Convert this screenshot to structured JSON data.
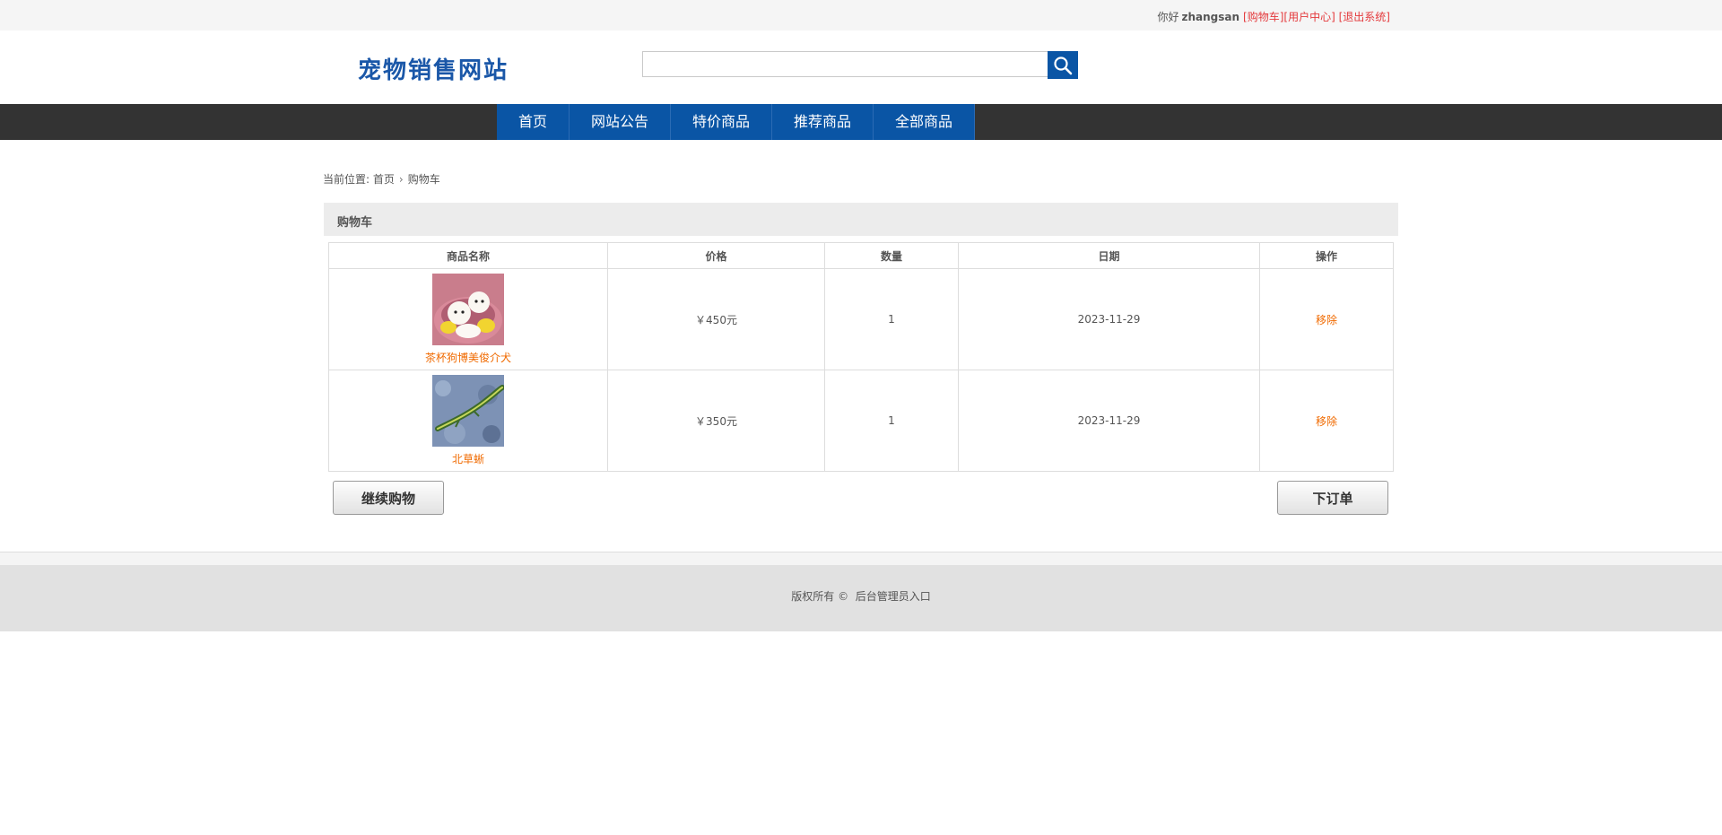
{
  "topbar": {
    "greeting": "你好",
    "username": "zhangsan",
    "links": [
      "[购物车]",
      "[用户中心]",
      "[退出系统]"
    ]
  },
  "header": {
    "logo": "宠物销售网站",
    "search_value": "",
    "search_icon": "search-icon"
  },
  "nav": {
    "items": [
      "首页",
      "网站公告",
      "特价商品",
      "推荐商品",
      "全部商品"
    ]
  },
  "breadcrumb": {
    "prefix": "当前位置: ",
    "home": "首页",
    "separator": "›",
    "current": "购物车"
  },
  "cart": {
    "title": "购物车",
    "columns": [
      "商品名称",
      "价格",
      "数量",
      "日期",
      "操作"
    ],
    "rows": [
      {
        "name": "茶杯狗博美俊介犬",
        "price": "￥450元",
        "qty": "1",
        "date": "2023-11-29",
        "action": "移除",
        "image": "white-puppies-in-basket"
      },
      {
        "name": "北草蜥",
        "price": "￥350元",
        "qty": "1",
        "date": "2023-11-29",
        "action": "移除",
        "image": "green-lizard"
      }
    ]
  },
  "buttons": {
    "continue": "继续购物",
    "order": "下订单"
  },
  "footer": {
    "copyright": "版权所有 ©",
    "admin_link": "后台管理员入口"
  },
  "colors": {
    "brand_blue": "#0a55a5",
    "nav_bg": "#333333",
    "link_orange": "#f06a00",
    "top_link_red": "#e4393c"
  }
}
